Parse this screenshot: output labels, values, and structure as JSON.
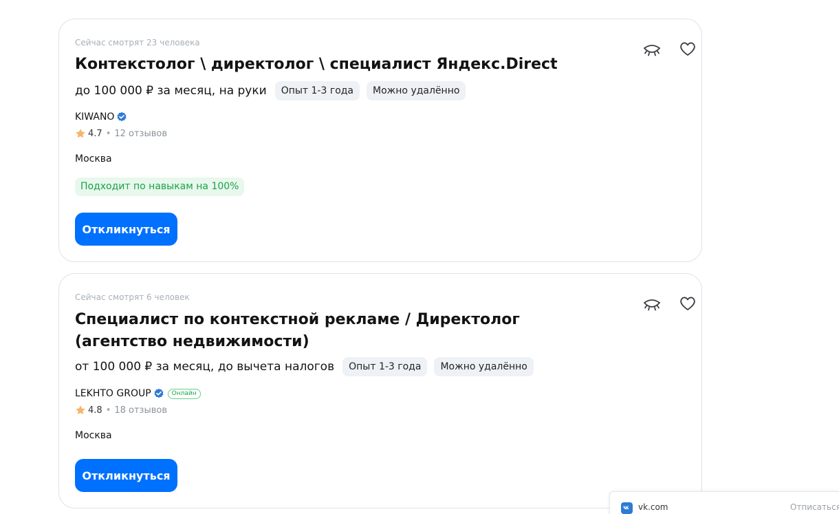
{
  "vacancies": [
    {
      "viewers": "Сейчас смотрят 23 человека",
      "title": "Контекстолог \\ директолог \\ специалист Яндекс.Direct",
      "salary": "до 100 000 ₽ за месяц, на руки",
      "experience": "Опыт 1-3 года",
      "remote": "Можно удалённо",
      "company": "KIWANO",
      "rating": "4.7",
      "reviews": "12 отзывов",
      "city": "Москва",
      "match": "Подходит по навыкам на 100%",
      "apply_label": "Откликнуться"
    },
    {
      "viewers": "Сейчас смотрят 6 человек",
      "title": "Специалист по контекстной рекламе / Директолог (агентство недвижимости)",
      "salary": "от 100 000 ₽ за месяц, до вычета налогов",
      "experience": "Опыт 1-3 года",
      "remote": "Можно удалённо",
      "company": "LEKHTO GROUP",
      "online_badge": "Онлайн",
      "rating": "4.8",
      "reviews": "18 отзывов",
      "city": "Москва",
      "apply_label": "Откликнуться"
    }
  ],
  "notification": {
    "site": "vk.com",
    "unsubscribe": "Отписаться"
  },
  "colors": {
    "accent": "#0070ff",
    "match_text": "#1ca04a",
    "match_bg": "#e8f8ec",
    "verified": "#2e7bd6",
    "star": "#f5b66b"
  },
  "icons": [
    "hide-eye-icon",
    "heart-icon",
    "verified-icon",
    "star-icon",
    "vk-logo-icon"
  ]
}
